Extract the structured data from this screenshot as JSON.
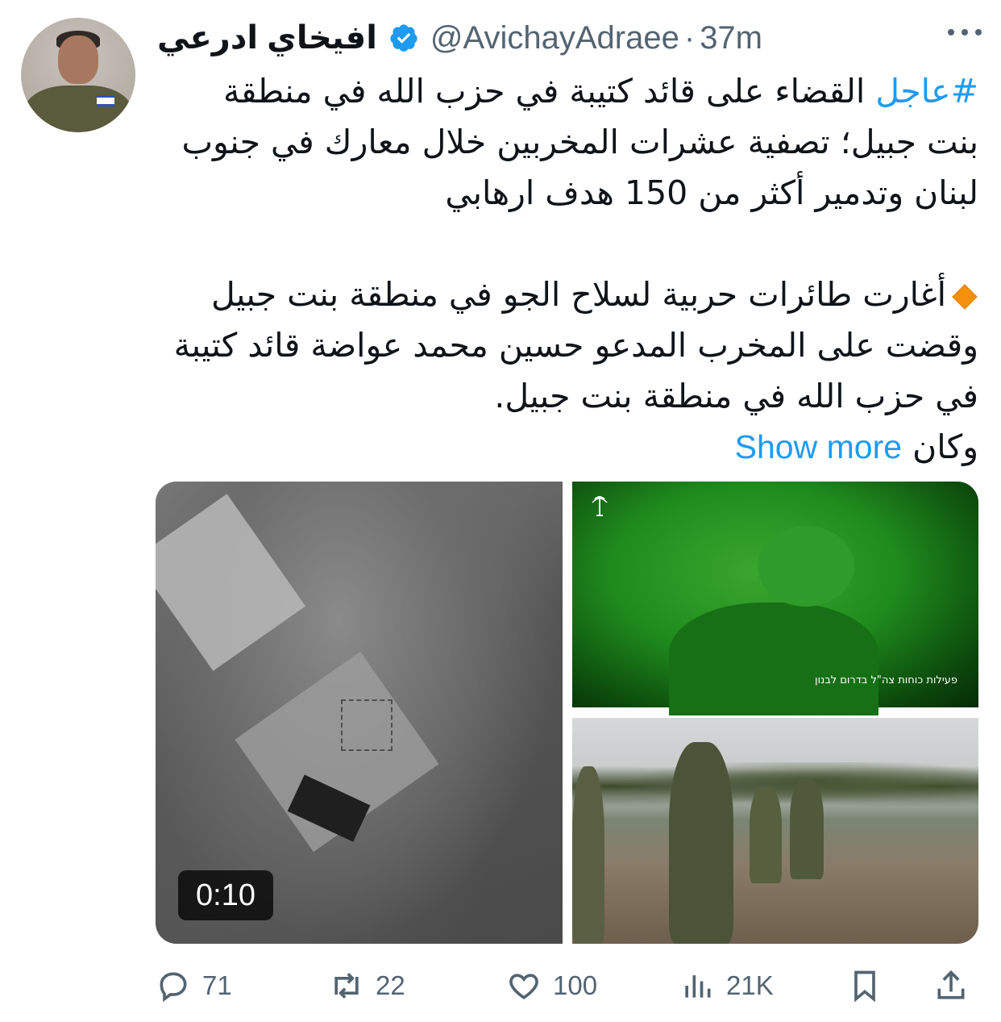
{
  "author": {
    "name": "افيخاي ادرعي",
    "handle": "@AvichayAdraee",
    "separator": "·",
    "time": "37m"
  },
  "tweet": {
    "hashtag": "#عاجل",
    "line1_rest": " القضاء على قائد كتيبة في حزب الله في منطقة بنت جبيل؛ تصفية عشرات المخربين خلال معارك في جنوب لبنان وتدمير أكثر من 150 هدف ارهابي",
    "paragraph2": "أغارت طائرات حربية لسلاح الجو في منطقة بنت جبيل وقضت على المخرب المدعو حسين محمد عواضة قائد كتيبة في حزب الله في منطقة بنت جبيل.",
    "paragraph2_tail": "وكان",
    "show_more": "Show more"
  },
  "media": {
    "video_duration": "0:10",
    "night_caption": "פעילות כוחות צה\"ל בדרום לבנון"
  },
  "actions": {
    "replies": "71",
    "reposts": "22",
    "likes": "100",
    "views": "21K"
  },
  "colors": {
    "accent": "#1d9bf0",
    "muted": "#536471",
    "text": "#0f1419"
  }
}
